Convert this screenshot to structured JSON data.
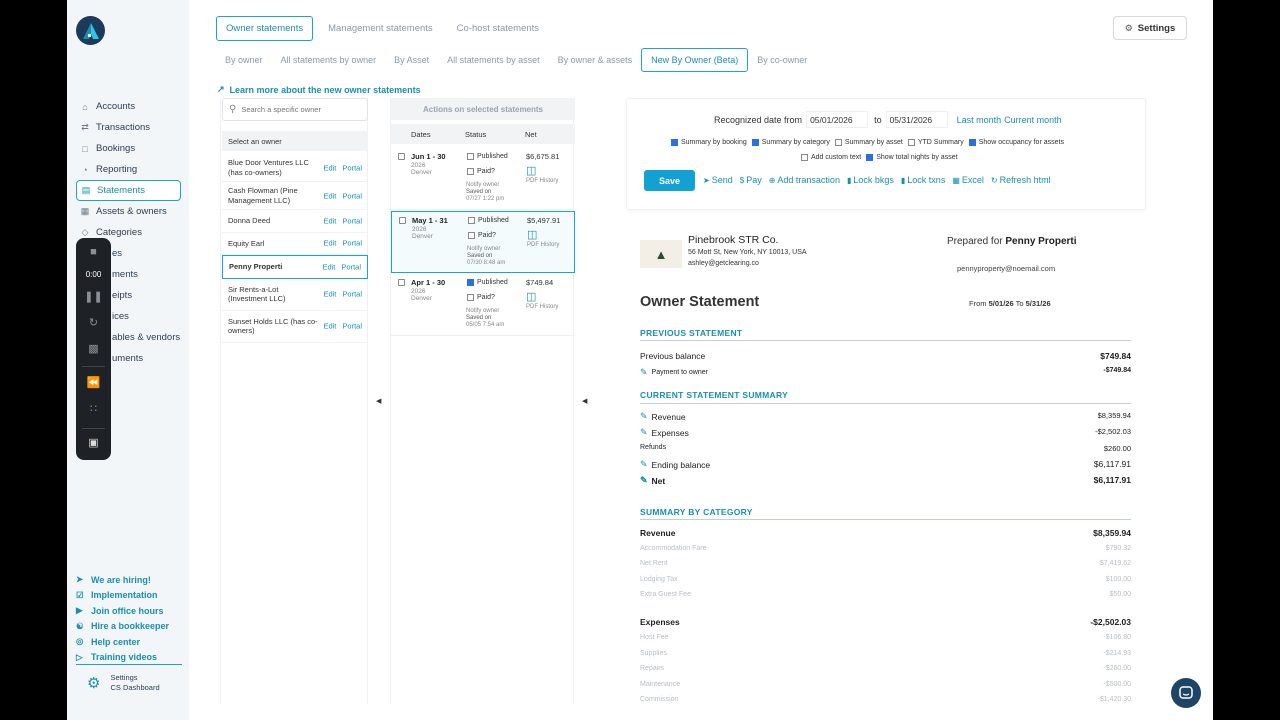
{
  "sidebar": {
    "items": [
      {
        "label": "Accounts",
        "icon": "bank-icon"
      },
      {
        "label": "Transactions",
        "icon": "transactions-icon"
      },
      {
        "label": "Bookings",
        "icon": "calendar-icon"
      },
      {
        "label": "Reporting",
        "icon": "reporting-icon"
      },
      {
        "label": "Statements",
        "icon": "statement-icon",
        "active": true
      },
      {
        "label": "Assets & owners",
        "icon": "assets-icon"
      },
      {
        "label": "Categories",
        "icon": "tag-icon"
      },
      {
        "label": "es",
        "icon": ""
      },
      {
        "label": "ments",
        "icon": ""
      },
      {
        "label": "eipts",
        "icon": ""
      },
      {
        "label": "ices",
        "icon": ""
      },
      {
        "label": "ables & vendors",
        "icon": ""
      },
      {
        "label": "uments",
        "icon": ""
      }
    ],
    "bottom_links": [
      {
        "label": "We are hiring!",
        "icon": "megaphone-icon"
      },
      {
        "label": "Implementation",
        "icon": "checklist-icon"
      },
      {
        "label": "Join office hours",
        "icon": "video-icon"
      },
      {
        "label": "Hire a bookkeeper",
        "icon": "handshake-icon"
      },
      {
        "label": "Help center",
        "icon": "globe-icon"
      },
      {
        "label": "Training videos",
        "icon": "play-icon"
      }
    ],
    "settings_label": "Settings",
    "settings_sub": "CS Dashboard"
  },
  "recorder": {
    "time": "0:00"
  },
  "top_tabs": [
    "Owner statements",
    "Management statements",
    "Co-host statements"
  ],
  "sub_tabs": [
    "By owner",
    "All statements by owner",
    "By Asset",
    "All statements by asset",
    "By owner & assets",
    "New By Owner (Beta)",
    "By co-owner"
  ],
  "settings_button": "Settings",
  "learn_link": "Learn more about the new owner statements",
  "owners": {
    "search_placeholder": "Search a specific owner",
    "header": "Select an owner",
    "edit": "Edit",
    "portal": "Portal",
    "list": [
      "Blue Door Ventures LLC (has co-owners)",
      "Cash Flowman (Pine Management LLC)",
      "Donna Deed",
      "Equity Earl",
      "Penny Properti",
      "Sir Rents-a-Lot (Investment LLC)",
      "Sunset Holds LLC (has co-owners)"
    ]
  },
  "statements": {
    "actions_header": "Actions on selected statements",
    "col_dates": "Dates",
    "col_status": "Status",
    "col_net": "Net",
    "published": "Published",
    "paid": "Paid?",
    "notify": "Notify owner",
    "pdf_history": "PDF History",
    "rows": [
      {
        "dates": "Jun 1 - 30",
        "year": "2026",
        "loc": "Denver",
        "saved": "Saved on",
        "saved_at": "07/27 1:22 pm",
        "net": "$6,675.81"
      },
      {
        "dates": "May 1 - 31",
        "year": "2026",
        "loc": "Denver",
        "saved": "Saved on",
        "saved_at": "07/30 8:48 am",
        "net": "$5,497.91"
      },
      {
        "dates": "Apr 1 - 30",
        "year": "2026",
        "loc": "Denver",
        "saved": "Saved on",
        "saved_at": "05/05 7:54 am",
        "net": "$749.84"
      }
    ]
  },
  "controls": {
    "date_label": "Recognized date from",
    "date_from": "05/01/2026",
    "to": "to",
    "date_to": "05/31/2026",
    "last_month": "Last month",
    "current_month": "Current month",
    "opts_row1": [
      "Summary by booking",
      "Summary by category",
      "Summary by asset",
      "YTD Summary",
      "Show occupancy for assets"
    ],
    "opts_row2": [
      "Add custom text",
      "Show total nights by asset"
    ],
    "save": "Save",
    "tools": [
      "Send",
      "Pay",
      "Add transaction",
      "Lock bkgs",
      "Lock txns",
      "Excel",
      "Refresh html"
    ]
  },
  "doc": {
    "company": "Pinebrook STR Co.",
    "address": "56 Mott St, New York, NY 10013, USA",
    "email": "ashley@getclearing.co",
    "prepared_prefix": "Prepared for",
    "prepared_for": "Penny Properti",
    "owner_email": "pennyproperty@noemail.com",
    "title": "Owner Statement",
    "from_label": "From",
    "from": "5/01/26",
    "to_label": "To",
    "to": "5/31/26",
    "prev_title": "PREVIOUS STATEMENT",
    "prev_balance_label": "Previous balance",
    "prev_balance": "$749.84",
    "payment_label": "Payment to owner",
    "payment": "-$749.84",
    "summary_title": "CURRENT STATEMENT SUMMARY",
    "revenue_label": "Revenue",
    "revenue": "$8,359.94",
    "expenses_label": "Expenses",
    "expenses": "-$2,502.03",
    "refunds_label": "Refunds",
    "refunds": "$260.00",
    "ending_label": "Ending balance",
    "ending": "$6,117.91",
    "net_label": "Net",
    "net": "$6,117.91",
    "category_title": "SUMMARY BY CATEGORY",
    "cat_revenue_label": "Revenue",
    "cat_revenue": "$8,359.94",
    "revenue_items": [
      {
        "label": "Accommodation Fare",
        "amt": "$790.32"
      },
      {
        "label": "Net Rent",
        "amt": "$7,419.62"
      },
      {
        "label": "Lodging Tax",
        "amt": "$100.00"
      },
      {
        "label": "Extra Guest Fee",
        "amt": "$50.00"
      }
    ],
    "cat_expenses_label": "Expenses",
    "cat_expenses": "-$2,502.03",
    "expense_items": [
      {
        "label": "Host Fee",
        "amt": "-$106.80"
      },
      {
        "label": "Supplies",
        "amt": "-$214.93"
      },
      {
        "label": "Repairs",
        "amt": "-$260.00"
      },
      {
        "label": "Maintenance",
        "amt": "-$500.00"
      },
      {
        "label": "Commission",
        "amt": "-$1,420.30"
      }
    ]
  },
  "colors": {
    "accent": "#1aa6c9",
    "link": "#1a8fb0",
    "save": "#13a1d3",
    "check": "#2b6fe0"
  }
}
